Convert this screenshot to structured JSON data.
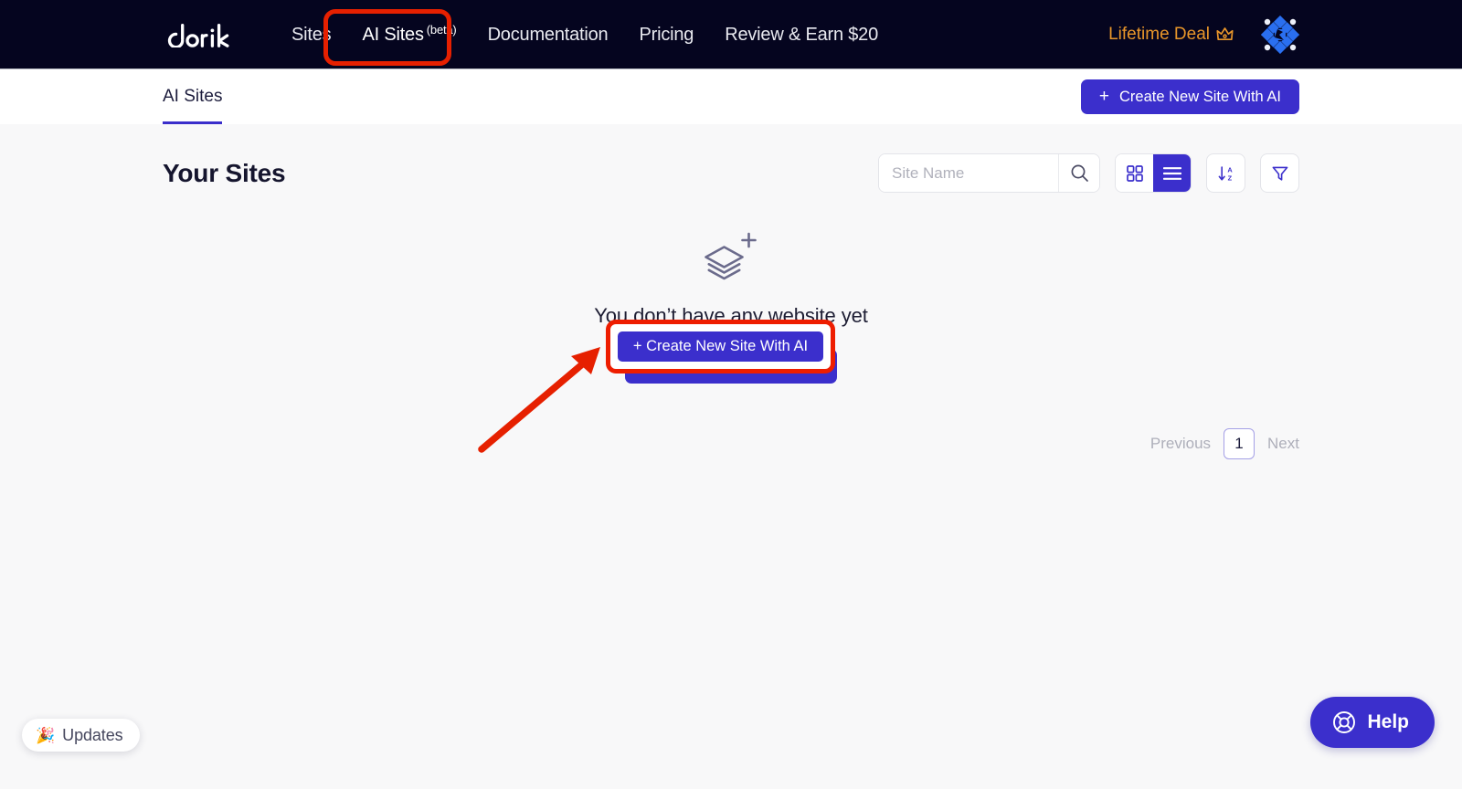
{
  "navbar": {
    "logo_text": "dorik",
    "links": [
      {
        "label": "Sites",
        "badge": "",
        "active": false
      },
      {
        "label": "AI Sites",
        "badge": "(beta)",
        "active": true
      },
      {
        "label": "Documentation",
        "badge": "",
        "active": false
      },
      {
        "label": "Pricing",
        "badge": "",
        "active": false
      },
      {
        "label": "Review & Earn $20",
        "badge": "",
        "active": false
      }
    ],
    "lifetime_deal_label": "Lifetime Deal",
    "crown_icon": "crown-icon",
    "avatar_icon": "avatar-identicon",
    "bg_color": "#05051f",
    "deal_color": "#e8962a"
  },
  "subheader": {
    "tab_label": "AI Sites",
    "create_button_label": "Create New Site With AI",
    "create_button_plus": "+",
    "accent_color": "#3b2fcc"
  },
  "main": {
    "page_title": "Your Sites",
    "search": {
      "placeholder": "Site Name",
      "value": "",
      "search_icon": "search-icon"
    },
    "view_toggle": {
      "grid_icon": "grid-view-icon",
      "list_icon": "list-view-icon",
      "active": "list"
    },
    "sort_icon": "sort-alpha-desc-icon",
    "filter_icon": "filter-funnel-icon"
  },
  "empty_state": {
    "icon": "layers-plus-icon",
    "message": "You don’t have any website yet",
    "button_label": "+ Create New Site With AI"
  },
  "pagination": {
    "previous_label": "Previous",
    "current_page": "1",
    "next_label": "Next",
    "border_color": "#a5a0e6"
  },
  "updates_widget": {
    "emoji": "🎉",
    "label": "Updates"
  },
  "help_widget": {
    "label": "Help",
    "icon": "lifebuoy-icon"
  },
  "annotations": {
    "nav_highlight_color": "#e62000",
    "button_highlight_color": "#ee1d00",
    "arrow_color": "#e62000"
  }
}
